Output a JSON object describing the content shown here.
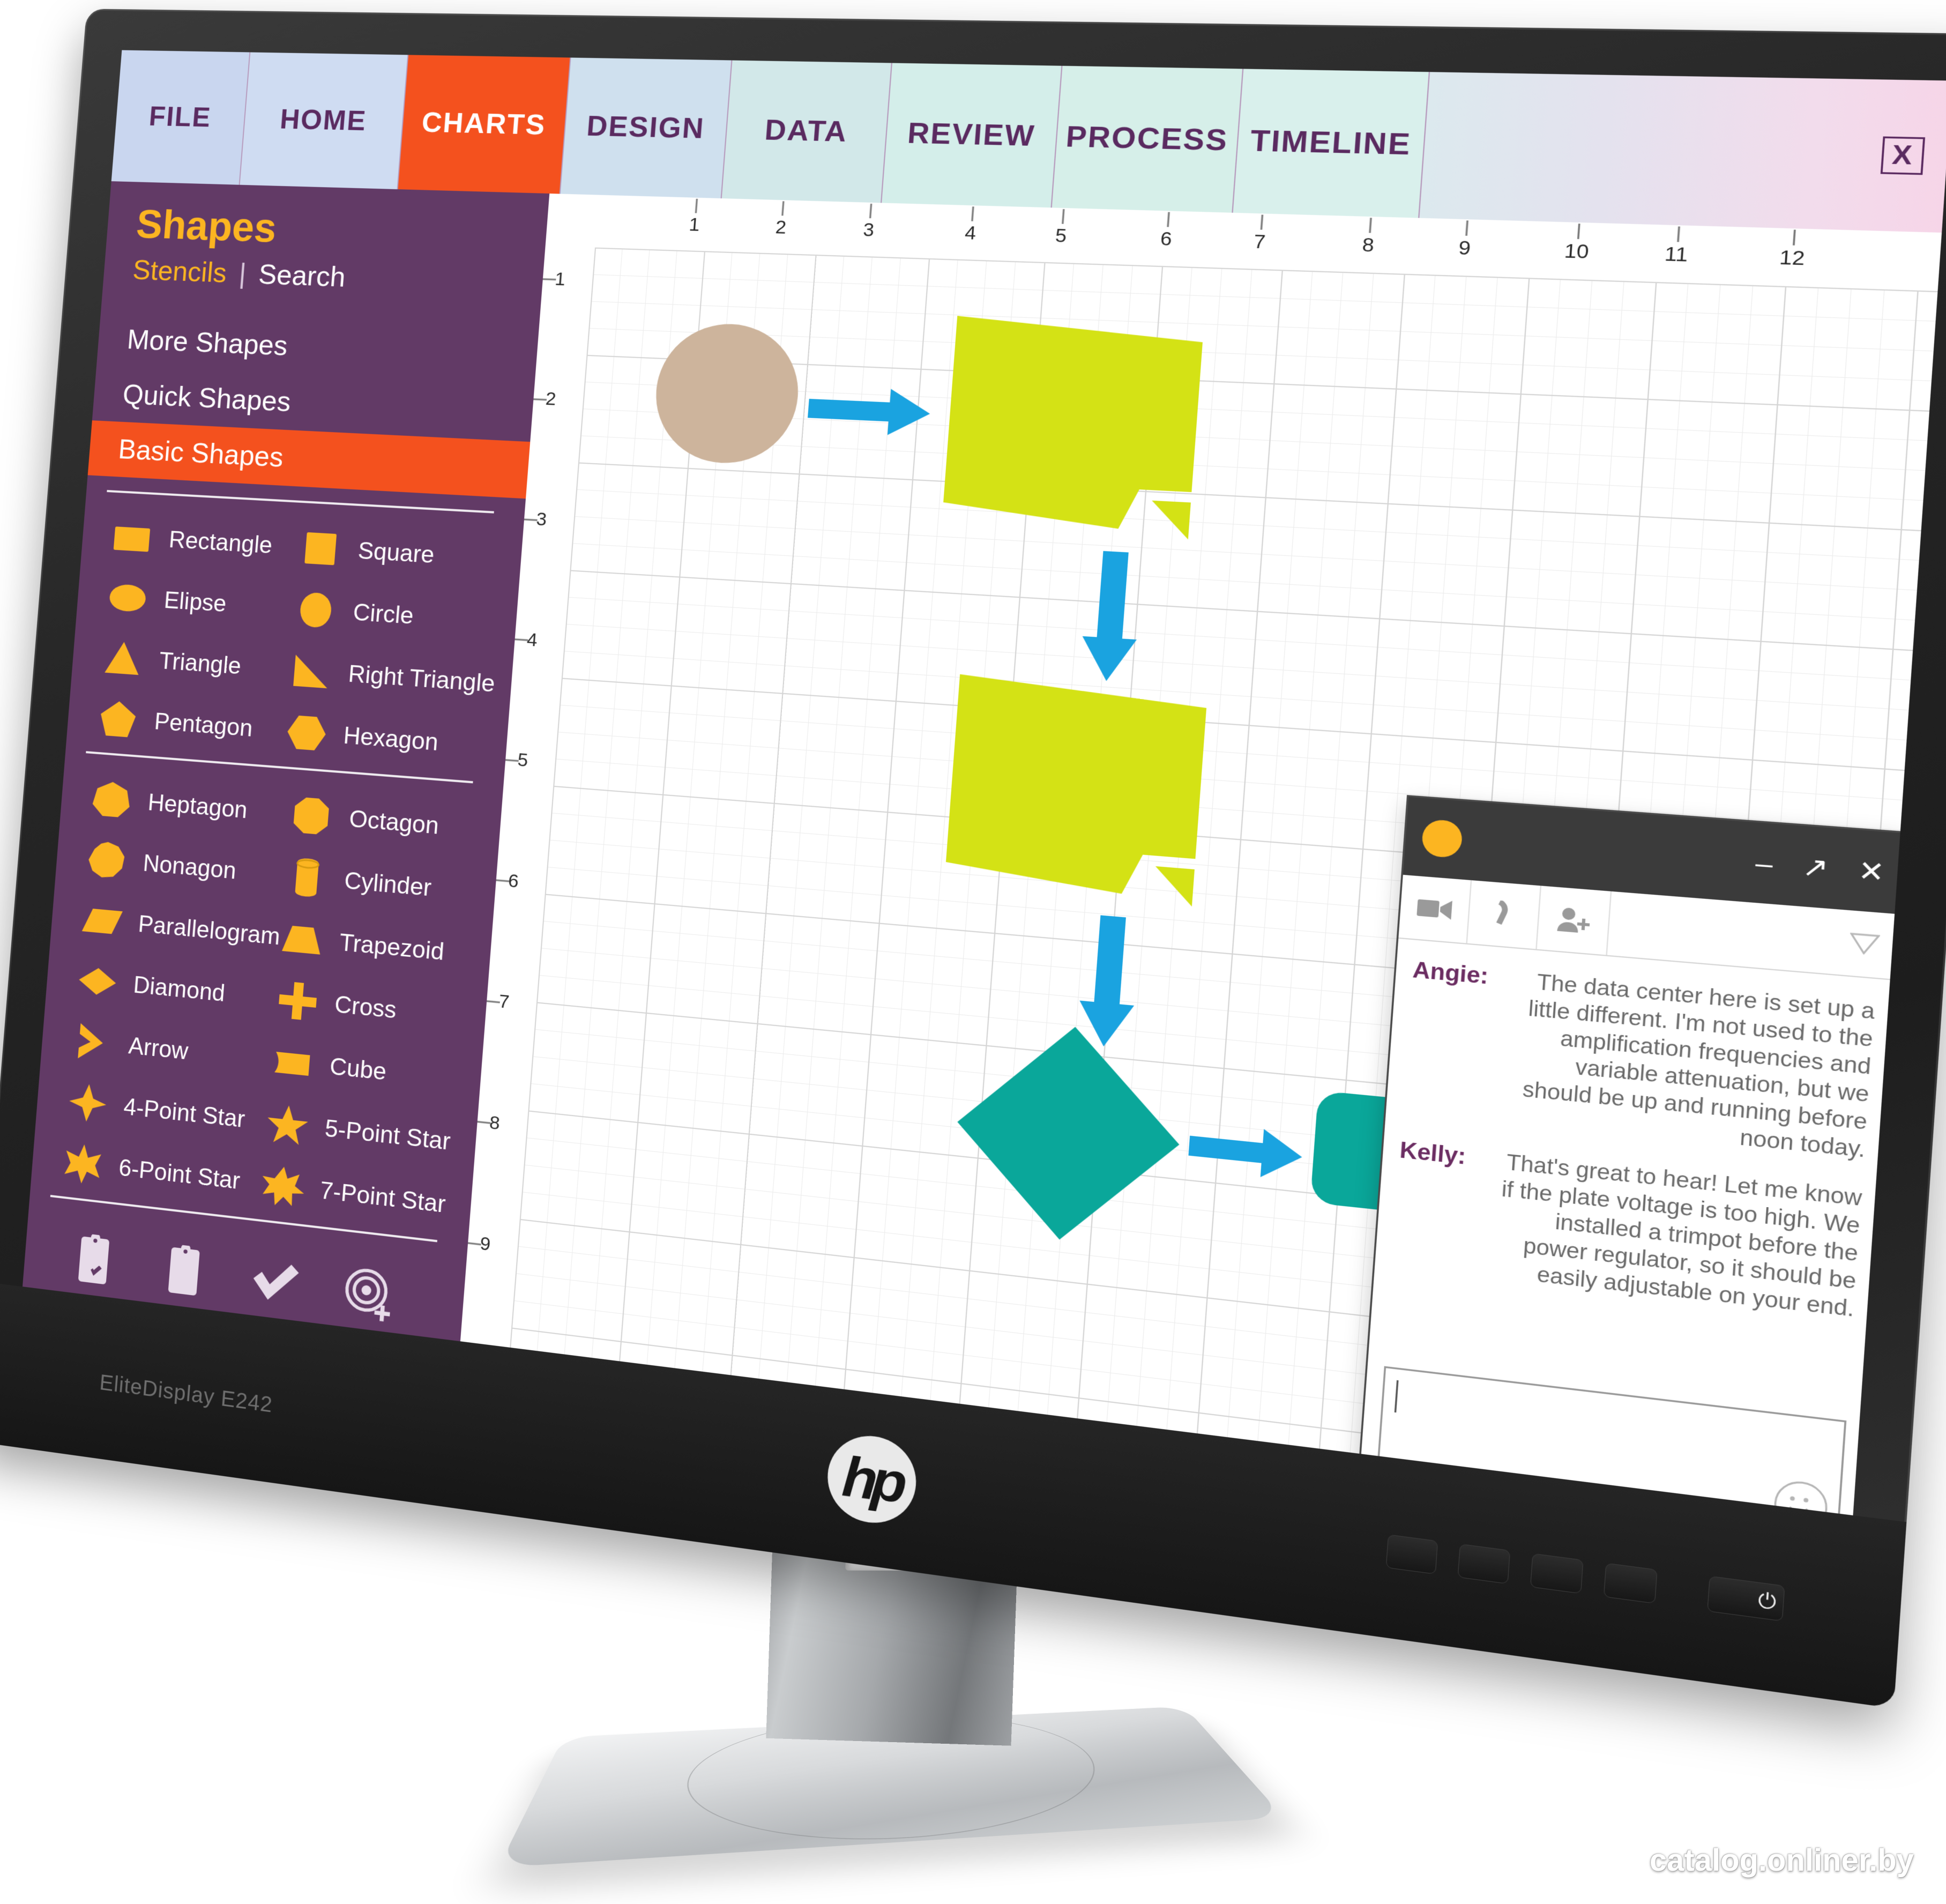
{
  "product": {
    "brand": "hp",
    "model_label": "EliteDisplay E242",
    "power_icon": "power-icon"
  },
  "watermark": "catalog.onliner.by",
  "ribbon": {
    "tabs": [
      {
        "label": "FILE",
        "active": false
      },
      {
        "label": "HOME",
        "active": false
      },
      {
        "label": "CHARTS",
        "active": true
      },
      {
        "label": "DESIGN",
        "active": false
      },
      {
        "label": "DATA",
        "active": false
      },
      {
        "label": "REVIEW",
        "active": false
      },
      {
        "label": "PROCESS",
        "active": false
      },
      {
        "label": "TIMELINE",
        "active": false
      }
    ],
    "close_label": "X",
    "active_color": "#f4511e",
    "tab_text_color": "#5a2a60"
  },
  "sidebar": {
    "title": "Shapes",
    "stencils_label": "Stencils",
    "separator": "|",
    "search_label": "Search",
    "nav": [
      {
        "label": "More Shapes",
        "active": false
      },
      {
        "label": "Quick Shapes",
        "active": false
      },
      {
        "label": "Basic Shapes",
        "active": true
      }
    ],
    "accent_color": "#fcb521",
    "panel_color": "#623a66",
    "shapes_group_1": [
      {
        "label": "Rectangle",
        "icon": "rectangle-icon"
      },
      {
        "label": "Square",
        "icon": "square-icon"
      },
      {
        "label": "Elipse",
        "icon": "ellipse-icon"
      },
      {
        "label": "Circle",
        "icon": "circle-icon"
      },
      {
        "label": "Triangle",
        "icon": "triangle-icon"
      },
      {
        "label": "Right Triangle",
        "icon": "right-triangle-icon"
      },
      {
        "label": "Pentagon",
        "icon": "pentagon-icon"
      },
      {
        "label": "Hexagon",
        "icon": "hexagon-icon"
      }
    ],
    "shapes_group_2": [
      {
        "label": "Heptagon",
        "icon": "heptagon-icon"
      },
      {
        "label": "Octagon",
        "icon": "octagon-icon"
      },
      {
        "label": "Nonagon",
        "icon": "nonagon-icon"
      },
      {
        "label": "Cylinder",
        "icon": "cylinder-icon"
      },
      {
        "label": "Parallelogram",
        "icon": "parallelogram-icon"
      },
      {
        "label": "Trapezoid",
        "icon": "trapezoid-icon"
      },
      {
        "label": "Diamond",
        "icon": "diamond-icon"
      },
      {
        "label": "Cross",
        "icon": "cross-icon"
      },
      {
        "label": "Arrow",
        "icon": "arrow-icon"
      },
      {
        "label": "Cube",
        "icon": "cube-icon"
      },
      {
        "label": "4-Point Star",
        "icon": "star-4-icon"
      },
      {
        "label": "5-Point Star",
        "icon": "star-5-icon"
      },
      {
        "label": "6-Point Star",
        "icon": "star-6-icon"
      },
      {
        "label": "7-Point Star",
        "icon": "star-7-icon"
      }
    ],
    "tools": [
      {
        "icon": "clipboard-check-icon"
      },
      {
        "icon": "clipboard-list-icon"
      },
      {
        "icon": "checkmark-icon"
      },
      {
        "icon": "target-add-icon"
      }
    ]
  },
  "canvas": {
    "ruler_h_ticks": [
      "1",
      "2",
      "3",
      "4",
      "5",
      "6",
      "7",
      "8",
      "9",
      "10",
      "11",
      "12"
    ],
    "ruler_v_ticks": [
      "1",
      "2",
      "3",
      "4",
      "5",
      "6",
      "7",
      "8",
      "9"
    ],
    "diagram_colors": {
      "start_ellipse": "#cdb49c",
      "process_box": "#d4e215",
      "decision": "#0aa79a",
      "terminator": "#0aa79a",
      "connector": "#1aa3e0"
    },
    "nodes": [
      {
        "name": "start-ellipse",
        "shape": "ellipse"
      },
      {
        "name": "process-box-1",
        "shape": "note"
      },
      {
        "name": "process-box-2",
        "shape": "note"
      },
      {
        "name": "decision-diamond",
        "shape": "diamond"
      },
      {
        "name": "end-rounded-rect",
        "shape": "rounded-rect"
      }
    ],
    "connectors": [
      {
        "name": "connector-right-1",
        "direction": "right"
      },
      {
        "name": "connector-down-1",
        "direction": "down"
      },
      {
        "name": "connector-down-2",
        "direction": "down"
      },
      {
        "name": "connector-right-2",
        "direction": "right"
      }
    ]
  },
  "chat": {
    "window_buttons": {
      "minimize": "–",
      "popout": "↗",
      "close": "✕"
    },
    "toolbar": [
      {
        "icon": "video-call-icon"
      },
      {
        "icon": "phone-call-icon"
      },
      {
        "icon": "add-person-icon"
      },
      {
        "icon": "chevron-down-icon"
      }
    ],
    "messages": [
      {
        "name": "Angie:",
        "text": "The data center here is set up a little different. I'm not used to the amplification frequencies and variable attenuation, but we should be up and running before noon today."
      },
      {
        "name": "Kelly:",
        "text": "That's great to hear! Let me know if the plate voltage is too high. We installed a trimpot before the power regulator, so it should be easily adjustable on your end."
      }
    ],
    "input_value": "",
    "input_placeholder": "",
    "emoji_icon": "smiley-icon"
  }
}
